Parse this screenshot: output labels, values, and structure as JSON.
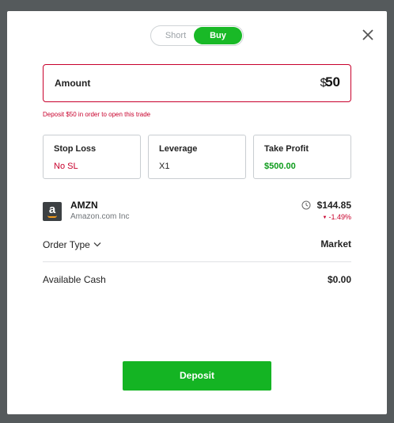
{
  "toggle": {
    "short_label": "Short",
    "buy_label": "Buy",
    "selected": "Buy"
  },
  "amount": {
    "label": "Amount",
    "currency": "$",
    "value": "50",
    "error": "Deposit $50 in order to open this trade"
  },
  "params": [
    {
      "label": "Stop Loss",
      "value": "No SL"
    },
    {
      "label": "Leverage",
      "value": "X1"
    },
    {
      "label": "Take Profit",
      "value": "$500.00"
    }
  ],
  "asset": {
    "ticker": "AMZN",
    "name": "Amazon.com Inc",
    "logo_glyph": "a",
    "price": "$144.85",
    "change": "-1.49%"
  },
  "order": {
    "label": "Order Type",
    "value": "Market"
  },
  "cash": {
    "label": "Available Cash",
    "value": "$0.00"
  },
  "deposit": {
    "label": "Deposit"
  },
  "icons": {
    "close": "close-icon",
    "clock": "clock-icon",
    "chevron": "chevron-down-icon",
    "down": "triangle-down-icon"
  },
  "colors": {
    "buy_green": "#19b927",
    "error_red": "#c8002c",
    "profit_green": "#0c9b1a",
    "button_green": "#14b423"
  }
}
